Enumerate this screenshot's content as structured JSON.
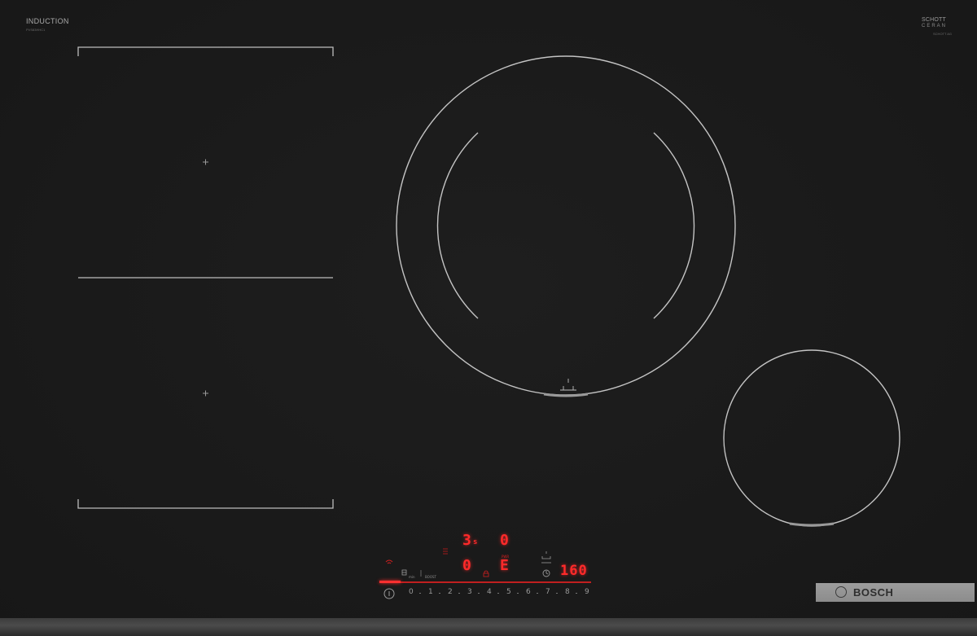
{
  "branding": {
    "left_title": "INDUCTION",
    "left_subtitle": "PVS83HHC1",
    "right_top": "SCHOTT",
    "right_middle": "CERAN",
    "right_subtitle": "SCHOTT AG",
    "logo": "BOSCH"
  },
  "display": {
    "zone_top_left_level": "3",
    "zone_top_left_sub": "s",
    "zone_top_right_level": "0",
    "zone_bottom_left_level": "0",
    "zone_bottom_right_level": "E",
    "temperature": "160",
    "power_label": "PWR",
    "boost_label": "BOOST",
    "timer_label": "min"
  },
  "power_scale": {
    "labels": [
      "0",
      "1",
      "2",
      "3",
      "4",
      "5",
      "6",
      "7",
      "8",
      "9"
    ]
  },
  "colors": {
    "glass": "#1b1b1b",
    "outline": "#b8b8b8",
    "display_red": "#ff2a2a",
    "logo_plate": "#959595"
  },
  "icons": {
    "info": "info-icon",
    "wifi": "wifi-icon",
    "timer": "clock-icon",
    "pan_sensor": "pan-sensor-icon",
    "lock": "lock-icon"
  }
}
